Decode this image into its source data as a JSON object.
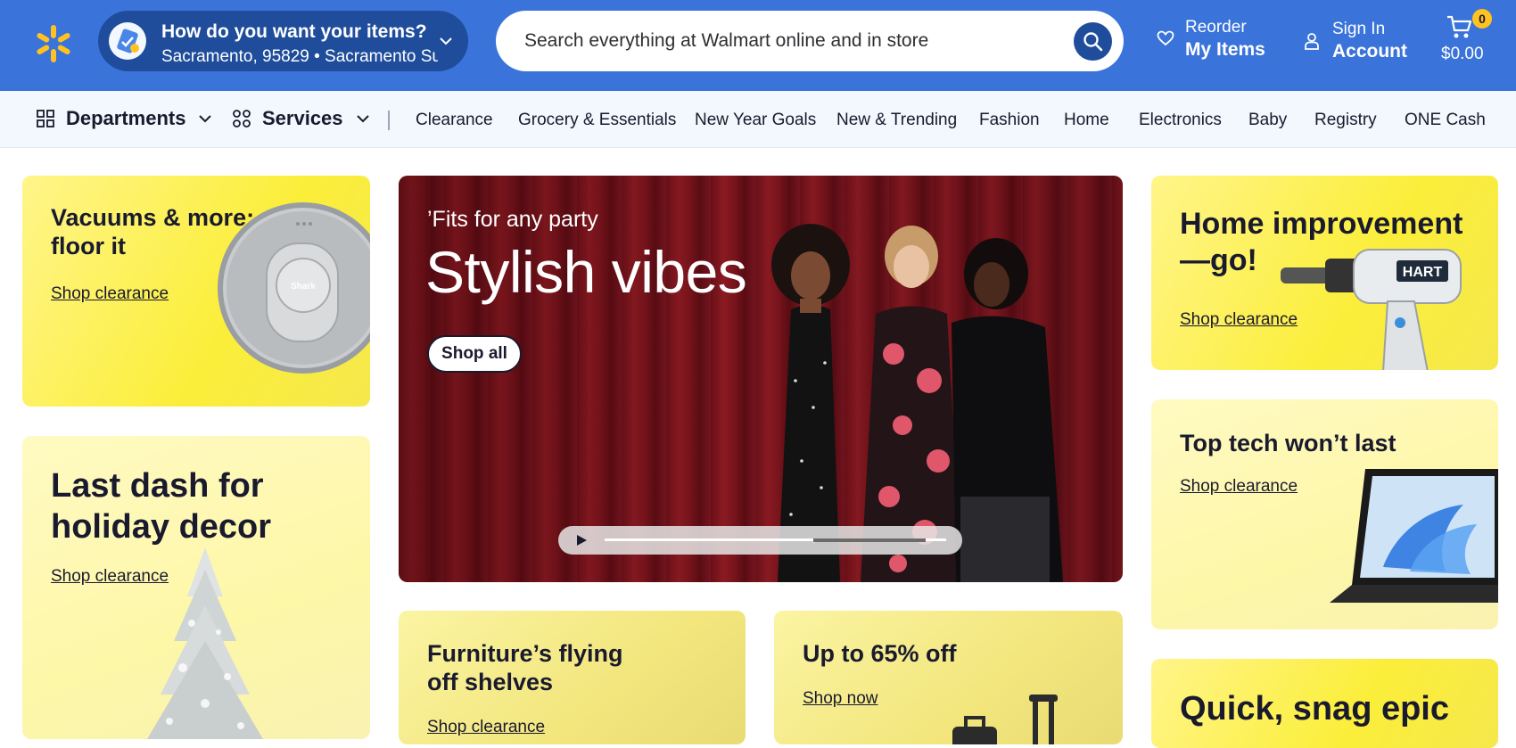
{
  "header": {
    "location": {
      "title": "How do you want your items?",
      "subtitle": "Sacramento, 95829 • Sacramento Su..."
    },
    "search": {
      "placeholder": "Search everything at Walmart online and in store"
    },
    "reorder": {
      "line1": "Reorder",
      "line2": "My Items"
    },
    "account": {
      "line1": "Sign In",
      "line2": "Account"
    },
    "cart": {
      "count": "0",
      "total": "$0.00"
    }
  },
  "nav": {
    "departments": "Departments",
    "services": "Services",
    "links": [
      "Clearance",
      "Grocery & Essentials",
      "New Year Goals",
      "New & Trending",
      "Fashion",
      "Home",
      "Electronics",
      "Baby",
      "Registry",
      "ONE Cash"
    ]
  },
  "cards": {
    "vacuums": {
      "title": "Vacuums & more: floor it",
      "link": "Shop clearance",
      "product_label": "Shark"
    },
    "holiday": {
      "title": "Last dash for holiday decor",
      "link": "Shop clearance"
    },
    "hero": {
      "subtitle": "’Fits for any party",
      "title": "Stylish vibes",
      "button": "Shop all",
      "video_progress": 0.94
    },
    "furniture": {
      "title": "Furniture’s flying off shelves",
      "link": "Shop clearance"
    },
    "sale": {
      "title": "Up to 65% off",
      "link": "Shop now"
    },
    "home_improvement": {
      "title": "Home improvement—go!",
      "link": "Shop clearance",
      "product_label": "HART"
    },
    "tech": {
      "title": "Top tech won’t last",
      "link": "Shop clearance"
    },
    "quick": {
      "title": "Quick, snag epic"
    }
  },
  "colors": {
    "header_blue": "#3a73d9",
    "dark_blue": "#1f4d9b",
    "spark_yellow": "#ffc220",
    "nav_bg": "#f2f8fd"
  },
  "icons": {
    "logo": "walmart-spark-icon",
    "search": "search-icon",
    "reorder": "heart-icon",
    "account": "person-icon",
    "cart": "cart-icon",
    "departments": "grid-icon",
    "services": "services-grid-icon",
    "chevron": "chevron-down-icon",
    "play": "play-icon"
  }
}
